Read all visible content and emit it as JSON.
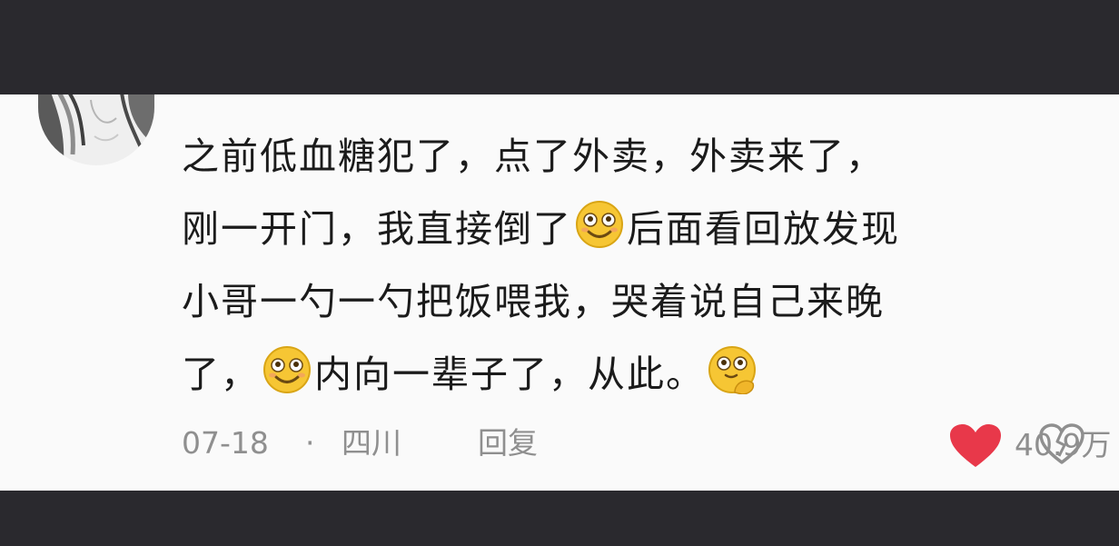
{
  "comment": {
    "lines": [
      [
        "之前低血糖犯了，点了外卖，外卖来了，"
      ],
      [
        "刚一开门，我直接倒了",
        "后面看回放发现"
      ],
      [
        "小哥一勺一勺把饭喂我，哭着说自己来晚"
      ],
      [
        "了，",
        "内向一辈子了，从此。"
      ]
    ],
    "emojis": [
      "smirk-face-emoji",
      "smirk-face-emoji",
      "thinking-face-emoji"
    ]
  },
  "meta": {
    "date": "07-18",
    "separator": "·",
    "location": "四川",
    "reply_label": "回复",
    "like_count": "40.9万"
  },
  "colors": {
    "heart": "#e8384a",
    "text": "#1b1b1b",
    "meta": "#8f8f8f",
    "background": "#fafafa",
    "frame": "#2a292e"
  }
}
